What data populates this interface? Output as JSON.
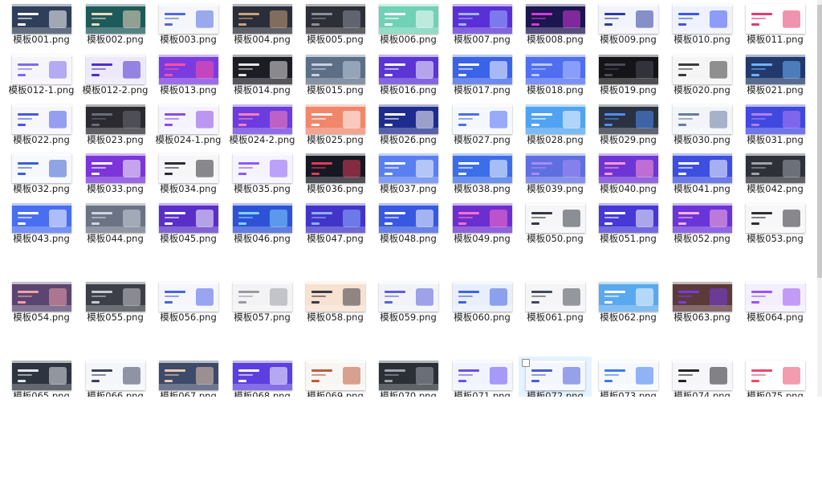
{
  "files": [
    {
      "name": "模板001.png",
      "bg": "#2f3f5a",
      "accent": "#ffffff"
    },
    {
      "name": "模板002.png",
      "bg": "#1d5a5a",
      "accent": "#f3d8c2"
    },
    {
      "name": "模板003.png",
      "bg": "#f4f6fb",
      "accent": "#5167e0"
    },
    {
      "name": "模板004.png",
      "bg": "#2a2d3a",
      "accent": "#c9a27a"
    },
    {
      "name": "模板005.png",
      "bg": "#2d2f36",
      "accent": "#8a8f9c"
    },
    {
      "name": "模板006.png",
      "bg": "#6fd1b6",
      "accent": "#ffffff"
    },
    {
      "name": "模板007.png",
      "bg": "#5a2fd6",
      "accent": "#9ab7ff"
    },
    {
      "name": "模板008.png",
      "bg": "#1b1550",
      "accent": "#d13bd9"
    },
    {
      "name": "模板009.png",
      "bg": "#f2f4fb",
      "accent": "#2e3c9e"
    },
    {
      "name": "模板010.png",
      "bg": "#eef2ff",
      "accent": "#3d55f2"
    },
    {
      "name": "模板011.png",
      "bg": "#ffffff",
      "accent": "#e33b6e"
    },
    {
      "name": "模板012-1.png",
      "bg": "#f7f5fc",
      "accent": "#7c6be8"
    },
    {
      "name": "模板012-2.png",
      "bg": "#ede9fb",
      "accent": "#4b2fcc"
    },
    {
      "name": "模板013.png",
      "bg": "#7a3ce0",
      "accent": "#ff4fa2"
    },
    {
      "name": "模板014.png",
      "bg": "#1c1c24",
      "accent": "#e6e6e6"
    },
    {
      "name": "模板015.png",
      "bg": "#5c6f86",
      "accent": "#c4d2e3"
    },
    {
      "name": "模板016.png",
      "bg": "#5b35d6",
      "accent": "#ffffff"
    },
    {
      "name": "模板017.png",
      "bg": "#3b63e8",
      "accent": "#ffffff"
    },
    {
      "name": "模板018.png",
      "bg": "#4f6ef0",
      "accent": "#b9c7ff"
    },
    {
      "name": "模板019.png",
      "bg": "#141419",
      "accent": "#4a4a57"
    },
    {
      "name": "模板020.png",
      "bg": "#f5f5f5",
      "accent": "#3a3a3a"
    },
    {
      "name": "模板021.png",
      "bg": "#223a6b",
      "accent": "#6fb2ff"
    },
    {
      "name": "模板022.png",
      "bg": "#f7f7fa",
      "accent": "#4657e8"
    },
    {
      "name": "模板023.png",
      "bg": "#2a2a30",
      "accent": "#6b6b78"
    },
    {
      "name": "模板024-1.png",
      "bg": "#f5f3ff",
      "accent": "#8a4be8"
    },
    {
      "name": "模板024-2.png",
      "bg": "#6b3ce0",
      "accent": "#ff7fb5"
    },
    {
      "name": "模板025.png",
      "bg": "#f0876a",
      "accent": "#ffffff"
    },
    {
      "name": "模板026.png",
      "bg": "#1f2c8f",
      "accent": "#ffffff"
    },
    {
      "name": "模板027.png",
      "bg": "#f5f7ff",
      "accent": "#4d6cf5"
    },
    {
      "name": "模板028.png",
      "bg": "#4fa3f2",
      "accent": "#ffffff"
    },
    {
      "name": "模板029.png",
      "bg": "#2a3140",
      "accent": "#4f8ef7"
    },
    {
      "name": "模板030.png",
      "bg": "#f2f4f8",
      "accent": "#6a7aa0"
    },
    {
      "name": "模板031.png",
      "bg": "#3f49e0",
      "accent": "#b07ef5"
    },
    {
      "name": "模板032.png",
      "bg": "#f7f8fc",
      "accent": "#3a5fd0"
    },
    {
      "name": "模板033.png",
      "bg": "#7b35d8",
      "accent": "#ffffff"
    },
    {
      "name": "模板034.png",
      "bg": "#f6f6f8",
      "accent": "#2c2c35"
    },
    {
      "name": "模板035.png",
      "bg": "#f5f3ff",
      "accent": "#8a5cf0"
    },
    {
      "name": "模板036.png",
      "bg": "#151820",
      "accent": "#e03a5c"
    },
    {
      "name": "模板037.png",
      "bg": "#5a7ff0",
      "accent": "#ffffff"
    },
    {
      "name": "模板038.png",
      "bg": "#3b6ee8",
      "accent": "#ffffff"
    },
    {
      "name": "模板039.png",
      "bg": "#5f6fe0",
      "accent": "#a78ef5"
    },
    {
      "name": "模板040.png",
      "bg": "#6e35d6",
      "accent": "#ff9ad1"
    },
    {
      "name": "模板041.png",
      "bg": "#3d4fe0",
      "accent": "#ffffff"
    },
    {
      "name": "模板042.png",
      "bg": "#2e3138",
      "accent": "#a0a4ad"
    },
    {
      "name": "模板043.png",
      "bg": "#4a6ef0",
      "accent": "#ffffff"
    },
    {
      "name": "模板044.png",
      "bg": "#6b7385",
      "accent": "#d0d5e0"
    },
    {
      "name": "模板045.png",
      "bg": "#5a2fc8",
      "accent": "#ffffff"
    },
    {
      "name": "模板046.png",
      "bg": "#2e52d6",
      "accent": "#7fd3ff"
    },
    {
      "name": "模板047.png",
      "bg": "#4035c8",
      "accent": "#8fb0ff"
    },
    {
      "name": "模板048.png",
      "bg": "#3758e0",
      "accent": "#ffffff"
    },
    {
      "name": "模板049.png",
      "bg": "#6b2fd0",
      "accent": "#ff6fc8"
    },
    {
      "name": "模板050.png",
      "bg": "#f6f6f8",
      "accent": "#333842"
    },
    {
      "name": "模板051.png",
      "bg": "#4639d6",
      "accent": "#ffffff"
    },
    {
      "name": "模板052.png",
      "bg": "#6a35d8",
      "accent": "#ffb0e0"
    },
    {
      "name": "模板053.png",
      "bg": "#f7f7f9",
      "accent": "#2d2d33"
    },
    {
      "name": "模板054.png",
      "bg": "#5a4670",
      "accent": "#f0a0a8"
    },
    {
      "name": "模板055.png",
      "bg": "#3d3f48",
      "accent": "#c8c8d0"
    },
    {
      "name": "模板056.png",
      "bg": "#f5f6fc",
      "accent": "#4a63e6"
    },
    {
      "name": "模板057.png",
      "bg": "#f3f3f5",
      "accent": "#9a9aa5"
    },
    {
      "name": "模板058.png",
      "bg": "#f7e1d0",
      "accent": "#3b3b46"
    },
    {
      "name": "模板059.png",
      "bg": "#f2f3f8",
      "accent": "#5a5fdc"
    },
    {
      "name": "模板060.png",
      "bg": "#e8eefc",
      "accent": "#3e63e0"
    },
    {
      "name": "模板061.png",
      "bg": "#f5f5f7",
      "accent": "#444a56"
    },
    {
      "name": "模板062.png",
      "bg": "#5aa9ee",
      "accent": "#ffffff"
    },
    {
      "name": "模板063.png",
      "bg": "#5c3a3a",
      "accent": "#7a3ce0"
    },
    {
      "name": "模板064.png",
      "bg": "#f3efff",
      "accent": "#9a55f0"
    },
    {
      "name": "模板065.png",
      "bg": "#2f3540",
      "accent": "#e3e6ec"
    },
    {
      "name": "模板066.png",
      "bg": "#f5f6f9",
      "accent": "#3a4260"
    },
    {
      "name": "模板067.png",
      "bg": "#3e4a6a",
      "accent": "#e8c8b0"
    },
    {
      "name": "模板068.png",
      "bg": "#5b3fe0",
      "accent": "#ffffff"
    },
    {
      "name": "模板069.png",
      "bg": "#f7f6f3",
      "accent": "#c05a3a"
    },
    {
      "name": "模板070.png",
      "bg": "#2b2f36",
      "accent": "#9ea3ad"
    },
    {
      "name": "模板071.png",
      "bg": "#f1f3ff",
      "accent": "#6a4ef0"
    },
    {
      "name": "模板072.png",
      "bg": "#f4f6fd",
      "accent": "#4a5bd8"
    },
    {
      "name": "模板073.png",
      "bg": "#f5f8ff",
      "accent": "#3d78f0"
    },
    {
      "name": "模板074.png",
      "bg": "#f6f6f8",
      "accent": "#222228"
    },
    {
      "name": "模板075.png",
      "bg": "#ffffff",
      "accent": "#e84a6a"
    }
  ],
  "hovered_index": 73,
  "scroll": {
    "position": 0.0
  }
}
